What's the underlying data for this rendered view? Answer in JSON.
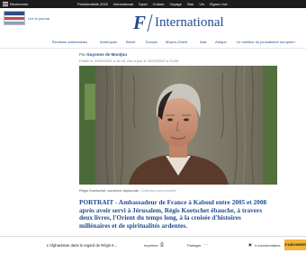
{
  "topbar": {
    "menu_label": "Rechercher",
    "nav": [
      "Présidentielle 2022",
      "International",
      "Sport",
      "Culture",
      "Voyage",
      "Star",
      "Vin",
      "Figaro Live"
    ]
  },
  "header": {
    "read_link": "Lire le journal",
    "logo_letter": "F",
    "logo_name": "International"
  },
  "section_nav": [
    "Élections américaines",
    "Amériques",
    "Brexit",
    "Europe",
    "Moyen-Orient",
    "Asie",
    "Afrique",
    "Le meilleur du journalisme européen"
  ],
  "article": {
    "byline_prefix": "Par",
    "author": "Guyonne de Montjou",
    "dates": "Publié le 20/09/2022 à 16:30, mis à jour le 20/09/2022 à 16:58",
    "caption_main": "Régis Koetschet, ancienne diplomate.",
    "caption_credit": "Collection personnelle",
    "lede": "PORTRAIT - Ambassadeur de France à Kaboul entre 2005 et 2008 après avoir servi à Jérusalem, Régis Koetschet ébauche, à travers deux livres, l'Orient du temps long, à la croisée d'histoires millénaires et de spiritualités ardentes."
  },
  "bottombar": {
    "title": "L'Afghanistan dans le regard de Régis K...",
    "print": "Imprimer",
    "share": "Partager",
    "comments": "4 commentaires",
    "subscribe": "S'ABONNER"
  },
  "colors": {
    "brand": "#1f4b8f",
    "topbar": "#1c1c1c",
    "subscribe": "#f0b43a"
  }
}
